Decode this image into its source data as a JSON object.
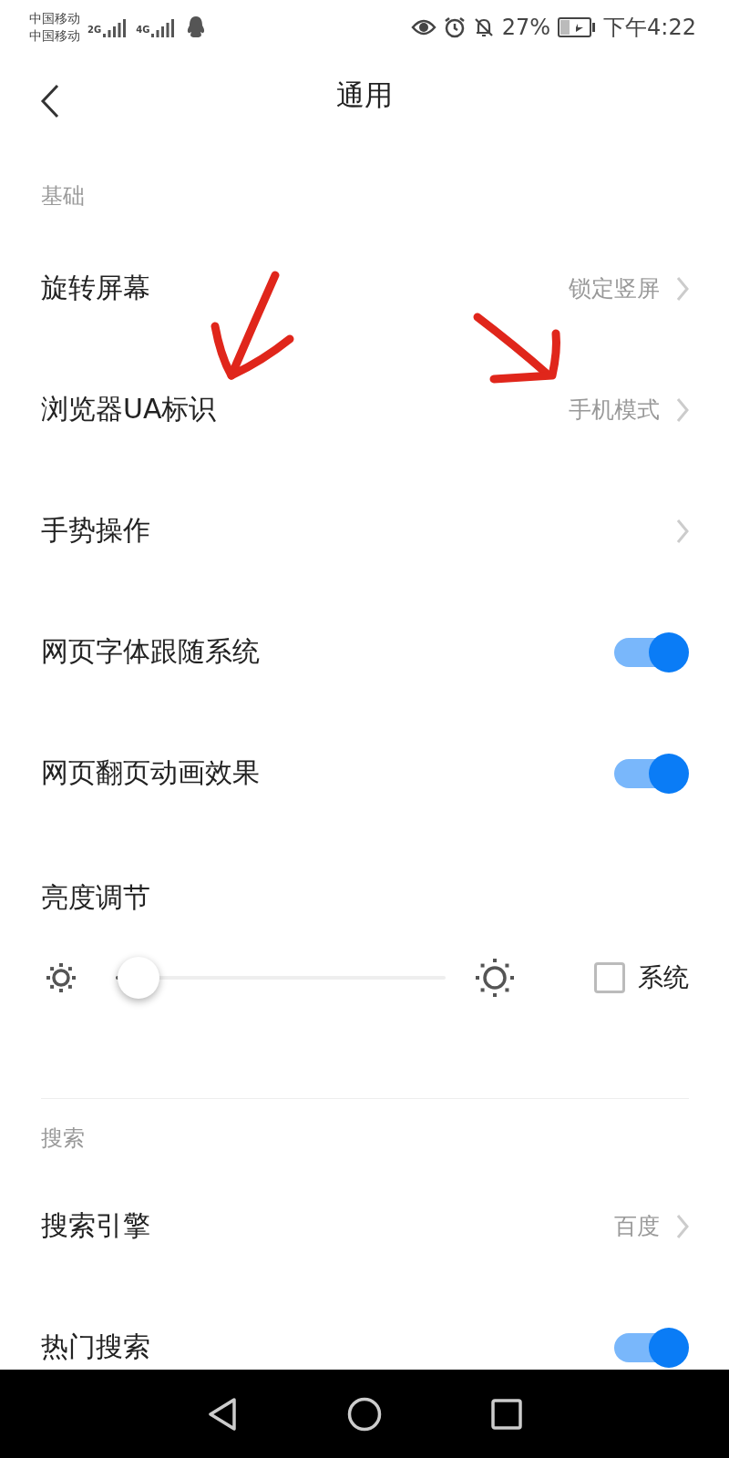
{
  "status_bar": {
    "carriers": [
      "中国移动",
      "中国移动"
    ],
    "networks": [
      "2G",
      "4G"
    ],
    "battery": "27%",
    "time": "下午4:22"
  },
  "header": {
    "title": "通用"
  },
  "sections": [
    {
      "title": "基础",
      "items": [
        {
          "kind": "link",
          "label": "旋转屏幕",
          "value": "锁定竖屏"
        },
        {
          "kind": "link",
          "label": "浏览器UA标识",
          "value": "手机模式"
        },
        {
          "kind": "link",
          "label": "手势操作"
        },
        {
          "kind": "toggle",
          "label": "网页字体跟随系统",
          "on": true
        },
        {
          "kind": "toggle",
          "label": "网页翻页动画效果",
          "on": true
        },
        {
          "kind": "slider",
          "label": "亮度调节",
          "level": 0.07,
          "checkbox_label": "系统",
          "checked": false
        }
      ]
    },
    {
      "title": "搜索",
      "items": [
        {
          "kind": "link",
          "label": "搜索引擎",
          "value": "百度"
        },
        {
          "kind": "toggle",
          "label": "热门搜索",
          "on": true
        }
      ]
    }
  ]
}
